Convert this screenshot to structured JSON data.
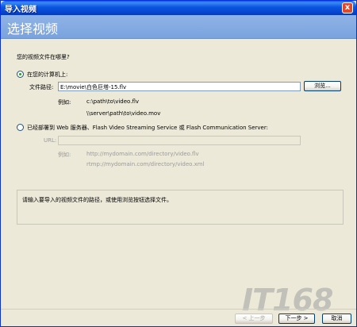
{
  "window": {
    "title": "导入视频",
    "close_glyph": "x"
  },
  "banner": {
    "heading": "选择视频"
  },
  "question": "您的视频文件在哪里?",
  "local": {
    "radio_label": "在您的计算机上:",
    "path_label": "文件路径:",
    "path_value": "E:\\movie\\白色巨塔-15.flv",
    "browse_label": "浏览...",
    "example_label": "例如:",
    "example_1": "c:\\path\\to\\video.flv",
    "example_2": "\\\\server\\path\\to\\video.mov"
  },
  "web": {
    "radio_label": "已经部署到 Web 服务器、Flash Video Streaming Service 或 Flash Communication Server:",
    "url_label": "URL:",
    "url_value": "",
    "example_label": "例如:",
    "example_1": "http://mydomain.com/directory/video.flv",
    "example_2": "rtmp://mydomain.com/directory/video.xml"
  },
  "info": {
    "message": "请输入要导入的视频文件的路径，或使用浏览按钮选择文件。"
  },
  "footer": {
    "back_label": "< 上一步",
    "next_label": "下一步 >",
    "cancel_label": "取消"
  },
  "watermark": "IT168",
  "colors": {
    "title_bar": "#0a55e0",
    "banner": "#7aa3de",
    "radio_dot": "#21a121"
  }
}
